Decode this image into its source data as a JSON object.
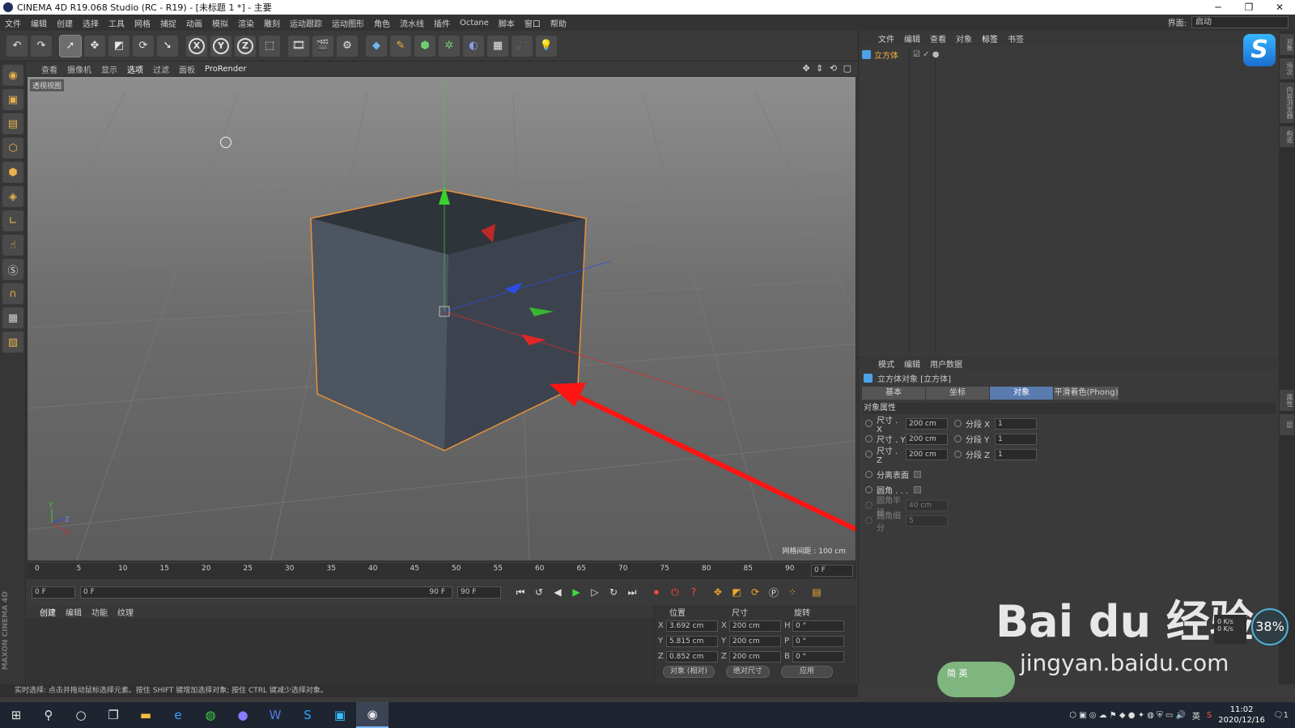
{
  "window": {
    "title": "CINEMA 4D R19.068 Studio (RC - R19) - [未标题 1 *] - 主要",
    "controls": [
      "─",
      "❐",
      "✕"
    ]
  },
  "menu": [
    "文件",
    "编辑",
    "创建",
    "选择",
    "工具",
    "网格",
    "捕捉",
    "动画",
    "模拟",
    "渲染",
    "雕刻",
    "运动跟踪",
    "运动图形",
    "角色",
    "流水线",
    "插件",
    "Octane",
    "脚本",
    "窗口",
    "帮助"
  ],
  "layout": {
    "label": "界面:",
    "value": "启动"
  },
  "toolbar_icons": [
    "undo-icon",
    "redo-icon",
    "live-select-icon",
    "move-icon",
    "scale-icon",
    "rotate-icon",
    "recent-tool-icon",
    "x-axis-icon",
    "y-axis-icon",
    "z-axis-icon",
    "world-coords-icon",
    "render-view-icon",
    "render-picture-viewer-icon",
    "render-settings-icon",
    "cube-primitive-icon",
    "pen-spline-icon",
    "subdivision-icon",
    "cloner-icon",
    "deformer-icon",
    "floor-icon",
    "camera-icon",
    "light-icon"
  ],
  "toolbar_axes": [
    "X",
    "Y",
    "Z"
  ],
  "left_tools": [
    "mode-model-icon",
    "mode-texture-icon",
    "mode-workplane-icon",
    "mode-points-icon",
    "mode-edges-icon",
    "mode-polygons-icon",
    "axis-icon",
    "tweak-icon",
    "snap-icon",
    "magnet-icon",
    "lock-workplane-icon",
    "texture-mode-icon"
  ],
  "maxon_logo": "MAXON CINEMA 4D",
  "viewport": {
    "menu": [
      "查看",
      "摄像机",
      "显示",
      "选项",
      "过滤",
      "面板",
      "ProRender"
    ],
    "active_menu": "选项",
    "label": "透视视图",
    "grid_spacing": "网格间距 : 100 cm",
    "axes_mini": [
      "Y",
      "Z",
      "X"
    ]
  },
  "timeline": {
    "ticks": [
      "0",
      "5",
      "10",
      "15",
      "20",
      "25",
      "30",
      "35",
      "40",
      "45",
      "50",
      "55",
      "60",
      "65",
      "70",
      "75",
      "80",
      "85",
      "90"
    ],
    "current_frame": "0 F",
    "start_field": "0 F",
    "range_start": "0 F",
    "range_end": "90 F",
    "end_field": "90 F"
  },
  "playback_icons": [
    "goto-start-icon",
    "prev-key-icon",
    "prev-frame-icon",
    "play-icon",
    "next-frame-icon",
    "loop-icon",
    "goto-end-icon",
    "record-icon",
    "autokey-icon",
    "keyframe-sel-icon",
    "position-key-icon",
    "scale-key-icon",
    "rotation-key-icon",
    "param-key-icon",
    "pla-key-icon",
    "timeline-icon"
  ],
  "material_manager": {
    "tabs": [
      "创建",
      "编辑",
      "功能",
      "纹理"
    ]
  },
  "coordinates": {
    "headers": [
      "位置",
      "尺寸",
      "旋转"
    ],
    "rows": [
      {
        "axis": "X",
        "pos": "3.692 cm",
        "size_axis": "X",
        "size": "200 cm",
        "rot_axis": "H",
        "rot": "0 °"
      },
      {
        "axis": "Y",
        "pos": "5.815 cm",
        "size_axis": "Y",
        "size": "200 cm",
        "rot_axis": "P",
        "rot": "0 °"
      },
      {
        "axis": "Z",
        "pos": "0.852 cm",
        "size_axis": "Z",
        "size": "200 cm",
        "rot_axis": "B",
        "rot": "0 °"
      }
    ],
    "mode_dropdown": "对象 (相对)",
    "size_dropdown": "绝对尺寸",
    "apply_button": "应用"
  },
  "status": "实时选择: 点击并拖动鼠标选择元素。按住 SHIFT 键增加选择对象; 按住 CTRL 键减少选择对象。",
  "object_manager": {
    "menu": [
      "文件",
      "编辑",
      "查看",
      "对象",
      "标签",
      "书签"
    ],
    "objects": [
      {
        "name": "立方体",
        "tags": "☑ ✓ ●"
      }
    ]
  },
  "attribute_manager": {
    "menu": [
      "模式",
      "编辑",
      "用户数据"
    ],
    "title": "立方体对象 [立方体]",
    "tabs": [
      "基本",
      "坐标",
      "对象",
      "平滑着色(Phong)"
    ],
    "selected_tab": "对象",
    "section": "对象属性",
    "params": [
      {
        "label": "尺寸 . X",
        "value": "200 cm",
        "seg_label": "分段 X",
        "seg_value": "1"
      },
      {
        "label": "尺寸 . Y",
        "value": "200 cm",
        "seg_label": "分段 Y",
        "seg_value": "1"
      },
      {
        "label": "尺寸 . Z",
        "value": "200 cm",
        "seg_label": "分段 Z",
        "seg_value": "1"
      }
    ],
    "separate_surfaces": "分离表面",
    "fillet": "圆角 . . .",
    "fillet_radius_label": "圆角半径",
    "fillet_radius": "40 cm",
    "fillet_subdiv_label": "圆角细分",
    "fillet_subdiv": "5"
  },
  "right_strip_tabs": [
    "对象",
    "场次",
    "内容浏览器",
    "构造",
    "属性",
    "层"
  ],
  "watermark": {
    "main": "Bai du 经验",
    "url": "jingyan.baidu.com"
  },
  "net": {
    "up": "0 K/s",
    "down": "0 K/s",
    "percent": "38%"
  },
  "ime": "简 英",
  "taskbar": {
    "apps": [
      "windows-start-icon",
      "search-icon",
      "cortana-icon",
      "task-view-icon",
      "file-explorer-icon",
      "edge-icon",
      "wechat-icon",
      "browser-icon",
      "word-icon",
      "sogou-icon",
      "notepad-icon",
      "cinema4d-icon"
    ],
    "tray_input": "英",
    "time": "11:02",
    "date": "2020/12/16",
    "notification": "1"
  },
  "colors": {
    "selection_orange": "#e8923a",
    "axis_x": "#e22626",
    "axis_y": "#3bd12e",
    "axis_z": "#2c4ce8",
    "annotation_arrow": "#ff1414",
    "tab_selected": "#5a7bb0"
  }
}
